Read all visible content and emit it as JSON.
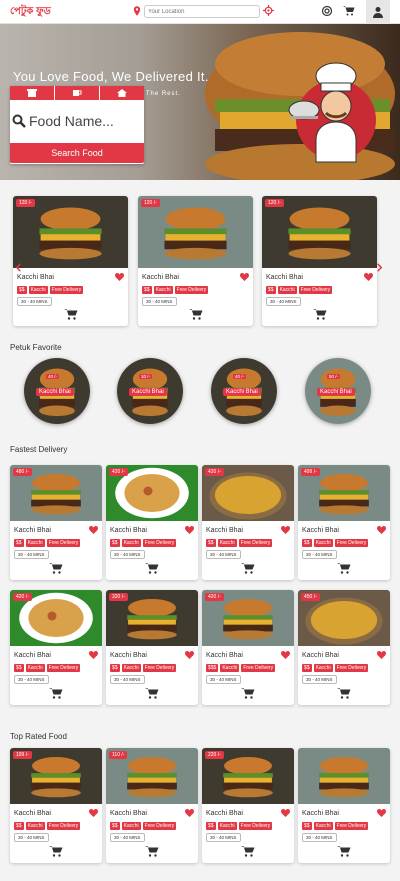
{
  "header": {
    "logo_text": "পেটুক ফুড",
    "location_placeholder": "Your Location",
    "icons": [
      "location-pin-icon",
      "target-icon",
      "support-icon",
      "cart-icon",
      "user-icon"
    ]
  },
  "hero": {
    "title": "You Love Food, We Delivered It.",
    "subtitle": "You Prepare The Food, We Handle The Rest.",
    "search": {
      "tabs": [
        "restaurant-icon",
        "cup-icon",
        "home-icon"
      ],
      "placeholder": "Food Name...",
      "button": "Search Food"
    }
  },
  "featured": [
    {
      "price": "120 /-",
      "name": "Kacchi Bhai",
      "tags": [
        "$$",
        "Kacchi",
        "Free Delivery"
      ],
      "mins": "30 - 40 MINS"
    },
    {
      "price": "120 /-",
      "name": "Kacchi Bhai",
      "tags": [
        "$$",
        "Kacchi",
        "Free Delivery"
      ],
      "mins": "30 - 40 MINS"
    },
    {
      "price": "120 /-",
      "name": "Kacchi Bhai",
      "tags": [
        "$$",
        "Kacchi",
        "Free Delivery"
      ],
      "mins": "30 - 40 MINS"
    }
  ],
  "favorite": {
    "title": "Petuk Favorite",
    "items": [
      {
        "price": "40 /-",
        "name": "Kacchi Bhai"
      },
      {
        "price": "10 /-",
        "name": "Kacchi Bhai"
      },
      {
        "price": "40 /-",
        "name": "Kacchi Bhai"
      },
      {
        "price": "50 /-",
        "name": "Kacchi Bhai"
      }
    ]
  },
  "fastest": {
    "title": "Fastest Delivery",
    "rows": [
      [
        {
          "price": "480 /-",
          "name": "Kacchi Bhai",
          "tags": [
            "$$",
            "Kacchi",
            "Free Delivery"
          ],
          "mins": "30 - 40 MINS",
          "img": "burger"
        },
        {
          "price": "420 /-",
          "name": "Kacchi Bhai",
          "tags": [
            "$$",
            "Kacchi",
            "Free Delivery"
          ],
          "mins": "30 - 40 MINS",
          "img": "biryani"
        },
        {
          "price": "420 /-",
          "name": "Kacchi Bhai",
          "tags": [
            "$$",
            "Kacchi",
            "Free Delivery"
          ],
          "mins": "30 - 40 MINS",
          "img": "rice"
        },
        {
          "price": "499 /-",
          "name": "Kacchi Bhai",
          "tags": [
            "$$",
            "Kacchi",
            "Free Delivery"
          ],
          "mins": "30 - 40 MINS",
          "img": "burger"
        }
      ],
      [
        {
          "price": "420 /-",
          "name": "Kacchi Bhai",
          "tags": [
            "$$",
            "Kacchi",
            "Free Delivery"
          ],
          "mins": "30 - 40 MINS",
          "img": "biryani"
        },
        {
          "price": "320 /-",
          "name": "Kacchi Bhai",
          "tags": [
            "$$",
            "Kacchi",
            "Free Delivery"
          ],
          "mins": "30 - 40 MINS",
          "img": "burger2"
        },
        {
          "price": "420 /-",
          "name": "Kacchi Bhai",
          "tags": [
            "$$$",
            "Kacchi",
            "Free Delivery"
          ],
          "mins": "30 - 40 MINS",
          "img": "burger"
        },
        {
          "price": "450 /-",
          "name": "Kacchi Bhai",
          "tags": [
            "$$",
            "Kacchi",
            "Free Delivery"
          ],
          "mins": "30 - 40 MINS",
          "img": "rice"
        }
      ]
    ]
  },
  "top_rated": {
    "title": "Top Rated Food",
    "items": [
      {
        "price": "199 /-",
        "name": "Kacchi Bhai",
        "tags": [
          "$$",
          "Kacchi",
          "Free Delivery"
        ],
        "mins": "30 - 40 MINS",
        "img": "burger2"
      },
      {
        "price": "110 /-",
        "name": "Kacchi Bhai",
        "tags": [
          "$$",
          "Kacchi",
          "Free Delivery"
        ],
        "mins": "30 - 40 MINS",
        "img": "burger"
      },
      {
        "price": "220 /-",
        "name": "Kacchi Bhai",
        "tags": [
          "$$",
          "Kacchi",
          "Free Delivery"
        ],
        "mins": "30 - 40 MINS",
        "img": "burger2"
      },
      {
        "price": "",
        "name": "Kacchi Bhai",
        "tags": [
          "$$",
          "Kacchi",
          "Free Delivery"
        ],
        "mins": "30 - 40 MINS",
        "img": "burger"
      }
    ]
  },
  "colors": {
    "accent": "#e23744",
    "background": "#f3f3f3"
  }
}
